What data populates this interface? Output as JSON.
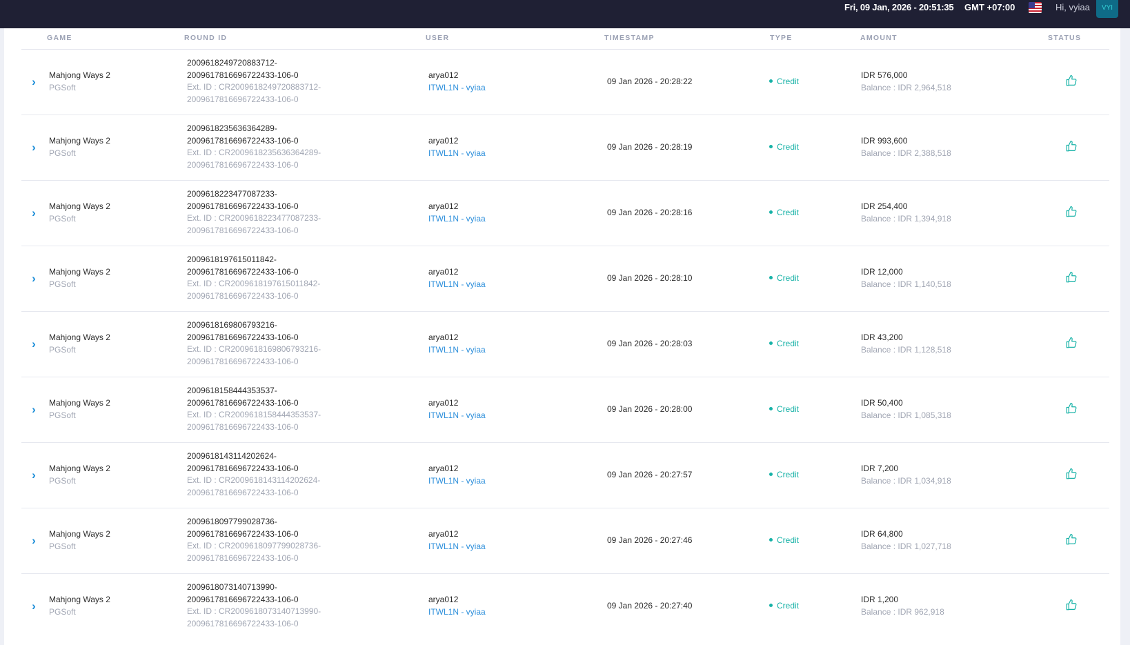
{
  "header": {
    "datetime": "Fri, 09 Jan, 2026 - 20:51:35",
    "timezone": "GMT +07:00",
    "greeting": "Hi, vyiaa",
    "avatar_initials": "VYI",
    "flag_icon": "us-flag-icon"
  },
  "table": {
    "columns": {
      "game": "GAME",
      "round_id": "ROUND ID",
      "user": "USER",
      "timestamp": "TIMESTAMP",
      "type": "TYPE",
      "amount": "AMOUNT",
      "status": "STATUS"
    },
    "rows": [
      {
        "game": "Mahjong Ways 2",
        "provider": "PGSoft",
        "round_id_1": "2009618249720883712-",
        "round_id_2": "2009617816696722433-106-0",
        "ext_id_1": "Ext. ID : CR2009618249720883712-",
        "ext_id_2": "2009617816696722433-106-0",
        "user": "arya012",
        "agent": "ITWL1N - vyiaa",
        "timestamp": "09 Jan 2026 - 20:28:22",
        "type": "Credit",
        "amount": "IDR 576,000",
        "balance": "Balance : IDR 2,964,518"
      },
      {
        "game": "Mahjong Ways 2",
        "provider": "PGSoft",
        "round_id_1": "2009618235636364289-",
        "round_id_2": "2009617816696722433-106-0",
        "ext_id_1": "Ext. ID : CR2009618235636364289-",
        "ext_id_2": "2009617816696722433-106-0",
        "user": "arya012",
        "agent": "ITWL1N - vyiaa",
        "timestamp": "09 Jan 2026 - 20:28:19",
        "type": "Credit",
        "amount": "IDR 993,600",
        "balance": "Balance : IDR 2,388,518"
      },
      {
        "game": "Mahjong Ways 2",
        "provider": "PGSoft",
        "round_id_1": "2009618223477087233-",
        "round_id_2": "2009617816696722433-106-0",
        "ext_id_1": "Ext. ID : CR2009618223477087233-",
        "ext_id_2": "2009617816696722433-106-0",
        "user": "arya012",
        "agent": "ITWL1N - vyiaa",
        "timestamp": "09 Jan 2026 - 20:28:16",
        "type": "Credit",
        "amount": "IDR 254,400",
        "balance": "Balance : IDR 1,394,918"
      },
      {
        "game": "Mahjong Ways 2",
        "provider": "PGSoft",
        "round_id_1": "2009618197615011842-",
        "round_id_2": "2009617816696722433-106-0",
        "ext_id_1": "Ext. ID : CR2009618197615011842-",
        "ext_id_2": "2009617816696722433-106-0",
        "user": "arya012",
        "agent": "ITWL1N - vyiaa",
        "timestamp": "09 Jan 2026 - 20:28:10",
        "type": "Credit",
        "amount": "IDR 12,000",
        "balance": "Balance : IDR 1,140,518"
      },
      {
        "game": "Mahjong Ways 2",
        "provider": "PGSoft",
        "round_id_1": "2009618169806793216-",
        "round_id_2": "2009617816696722433-106-0",
        "ext_id_1": "Ext. ID : CR2009618169806793216-",
        "ext_id_2": "2009617816696722433-106-0",
        "user": "arya012",
        "agent": "ITWL1N - vyiaa",
        "timestamp": "09 Jan 2026 - 20:28:03",
        "type": "Credit",
        "amount": "IDR 43,200",
        "balance": "Balance : IDR 1,128,518"
      },
      {
        "game": "Mahjong Ways 2",
        "provider": "PGSoft",
        "round_id_1": "2009618158444353537-",
        "round_id_2": "2009617816696722433-106-0",
        "ext_id_1": "Ext. ID : CR2009618158444353537-",
        "ext_id_2": "2009617816696722433-106-0",
        "user": "arya012",
        "agent": "ITWL1N - vyiaa",
        "timestamp": "09 Jan 2026 - 20:28:00",
        "type": "Credit",
        "amount": "IDR 50,400",
        "balance": "Balance : IDR 1,085,318"
      },
      {
        "game": "Mahjong Ways 2",
        "provider": "PGSoft",
        "round_id_1": "2009618143114202624-",
        "round_id_2": "2009617816696722433-106-0",
        "ext_id_1": "Ext. ID : CR2009618143114202624-",
        "ext_id_2": "2009617816696722433-106-0",
        "user": "arya012",
        "agent": "ITWL1N - vyiaa",
        "timestamp": "09 Jan 2026 - 20:27:57",
        "type": "Credit",
        "amount": "IDR 7,200",
        "balance": "Balance : IDR 1,034,918"
      },
      {
        "game": "Mahjong Ways 2",
        "provider": "PGSoft",
        "round_id_1": "2009618097799028736-",
        "round_id_2": "2009617816696722433-106-0",
        "ext_id_1": "Ext. ID : CR2009618097799028736-",
        "ext_id_2": "2009617816696722433-106-0",
        "user": "arya012",
        "agent": "ITWL1N - vyiaa",
        "timestamp": "09 Jan 2026 - 20:27:46",
        "type": "Credit",
        "amount": "IDR 64,800",
        "balance": "Balance : IDR 1,027,718"
      },
      {
        "game": "Mahjong Ways 2",
        "provider": "PGSoft",
        "round_id_1": "2009618073140713990-",
        "round_id_2": "2009617816696722433-106-0",
        "ext_id_1": "Ext. ID : CR2009618073140713990-",
        "ext_id_2": "2009617816696722433-106-0",
        "user": "arya012",
        "agent": "ITWL1N - vyiaa",
        "timestamp": "09 Jan 2026 - 20:27:40",
        "type": "Credit",
        "amount": "IDR 1,200",
        "balance": "Balance : IDR 962,918"
      }
    ]
  },
  "icons": {
    "expand": "chevron-right-icon",
    "status": "thumbs-up-icon"
  },
  "colors": {
    "topbar": "#1f2034",
    "link": "#2d8fdb",
    "credit": "#17b2a7",
    "chevron": "#1b8dd8"
  }
}
